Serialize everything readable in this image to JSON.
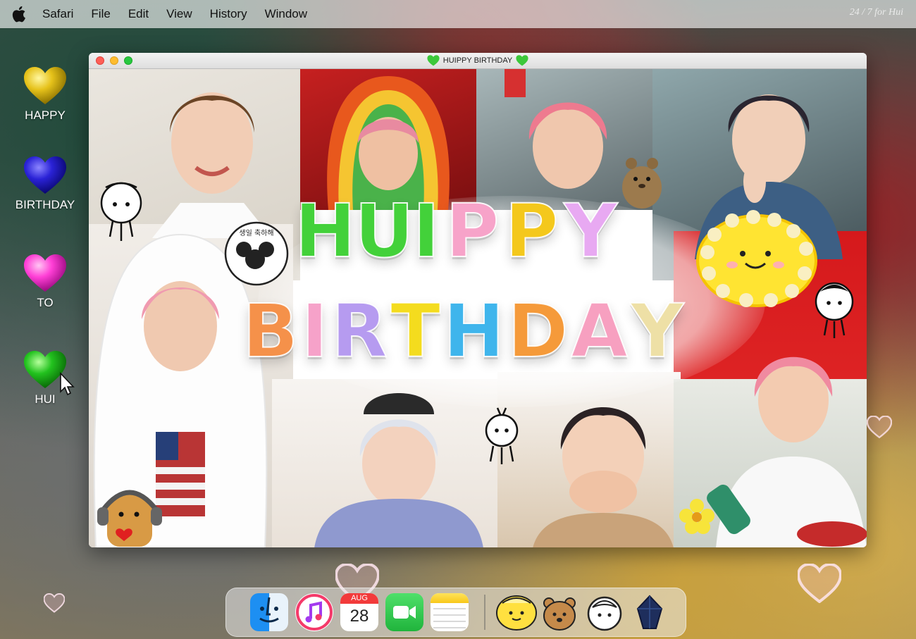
{
  "menubar": {
    "app_name": "Safari",
    "items": [
      "File",
      "Edit",
      "View",
      "History",
      "Window"
    ],
    "right_text": "24 / 7 for Hui"
  },
  "desktop": {
    "icons": [
      {
        "label": "HAPPY",
        "icon": "yellow-heart-icon",
        "color": "#e6c21a"
      },
      {
        "label": "BIRTHDAY",
        "icon": "blue-heart-icon",
        "color": "#2a22d6"
      },
      {
        "label": "TO",
        "icon": "pink-heart-icon",
        "color": "#ff3fd6"
      },
      {
        "label": "HUI",
        "icon": "green-heart-icon",
        "color": "#22c21e"
      }
    ]
  },
  "window": {
    "title": "HUIPPY BIRTHDAY",
    "title_emoji": "green-heart-icon"
  },
  "banner": {
    "line1": [
      {
        "text": "HUI",
        "color": "#43d13a"
      },
      {
        "text": "P",
        "color": "#f7a3c9"
      },
      {
        "text": "P",
        "color": "#f4c81c"
      },
      {
        "text": "Y",
        "color": "#e8a9f2"
      }
    ],
    "line2": [
      {
        "text": "B",
        "color": "#f5914a"
      },
      {
        "text": "I",
        "color": "#f6a2c9"
      },
      {
        "text": "R",
        "color": "#b69bf0"
      },
      {
        "text": "T",
        "color": "#f4dc1e"
      },
      {
        "text": "H",
        "color": "#3fb5ec"
      },
      {
        "text": "D",
        "color": "#f59a3a"
      },
      {
        "text": "A",
        "color": "#f7a0c0"
      },
      {
        "text": "Y",
        "color": "#eee0a6"
      }
    ]
  },
  "dock": {
    "apps": [
      "finder-icon",
      "music-icon",
      "calendar-icon",
      "facetime-icon",
      "notes-icon"
    ],
    "calendar": {
      "month": "AUG",
      "day": "28"
    },
    "stickers": [
      "sun-sticker-icon",
      "bear-sticker-icon",
      "doodle-face-sticker-icon",
      "crystal-sticker-icon"
    ]
  }
}
